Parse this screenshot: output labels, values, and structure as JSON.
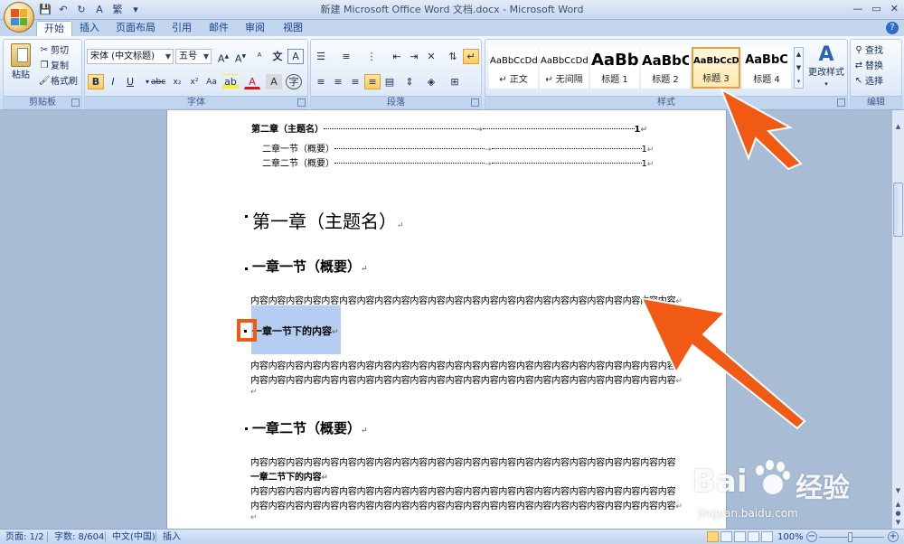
{
  "window": {
    "title": "新建 Microsoft Office Word 文档.docx - Microsoft Word",
    "controls": [
      "—",
      "▭",
      "✕"
    ]
  },
  "quick_access": [
    "💾",
    "↶",
    "↻",
    "A",
    "繁",
    "▾"
  ],
  "tabs": [
    {
      "label": "开始",
      "active": true
    },
    {
      "label": "插入"
    },
    {
      "label": "页面布局"
    },
    {
      "label": "引用"
    },
    {
      "label": "邮件"
    },
    {
      "label": "审阅"
    },
    {
      "label": "视图"
    }
  ],
  "ribbon": {
    "clipboard": {
      "label": "剪贴板",
      "paste": "粘贴",
      "cut": "剪切",
      "copy": "复制",
      "format_painter": "格式刷"
    },
    "font": {
      "label": "字体",
      "font_name": "宋体 (中文标题)",
      "font_size": "五号"
    },
    "paragraph": {
      "label": "段落"
    },
    "styles": {
      "label": "样式",
      "items": [
        {
          "sample": "AaBbCcDd",
          "name": "↵ 正文"
        },
        {
          "sample": "AaBbCcDd",
          "name": "↵ 无间隔"
        },
        {
          "sample": "AaBb",
          "name": "标题 1"
        },
        {
          "sample": "AaBbC",
          "name": "标题 2"
        },
        {
          "sample": "AaBbCcDd",
          "name": "标题 3",
          "selected": true
        },
        {
          "sample": "AaBbC",
          "name": "标题 4"
        }
      ],
      "change_styles": "更改样式"
    },
    "editing": {
      "label": "编辑",
      "find": "查找",
      "replace": "替换",
      "select": "选择"
    }
  },
  "document": {
    "toc": [
      {
        "text": "第二章（主题名）",
        "page": "1",
        "level": 1
      },
      {
        "text": "二章一节（概要）",
        "page": "1",
        "level": 2
      },
      {
        "text": "二章二节（概要）",
        "page": "1",
        "level": 2
      }
    ],
    "chapter1": "第一章（主题名）",
    "section11": "一章一节（概要）",
    "body_line": "内容内容内容内容内容内容内容内容内容内容内容内容内容内容内容内容内容内容内容内容内容内容内容内容",
    "sub11": "一章一节下的内容",
    "section12": "一章二节（概要）",
    "sub12": "一章二节下的内容",
    "return_mark": "↵",
    "tab_mark": "→"
  },
  "status": {
    "page": "页面: 1/2",
    "words": "字数: 8/604",
    "language": "中文(中国)",
    "mode": "插入",
    "zoom": "100%"
  },
  "watermark": {
    "brand": "Bai",
    "brand2": "经验",
    "url": "jingyan.baidu.com"
  },
  "colors": {
    "accent_arrow": "#f05a14",
    "selection": "#b5cdf0",
    "ribbon_text": "#15428b"
  }
}
